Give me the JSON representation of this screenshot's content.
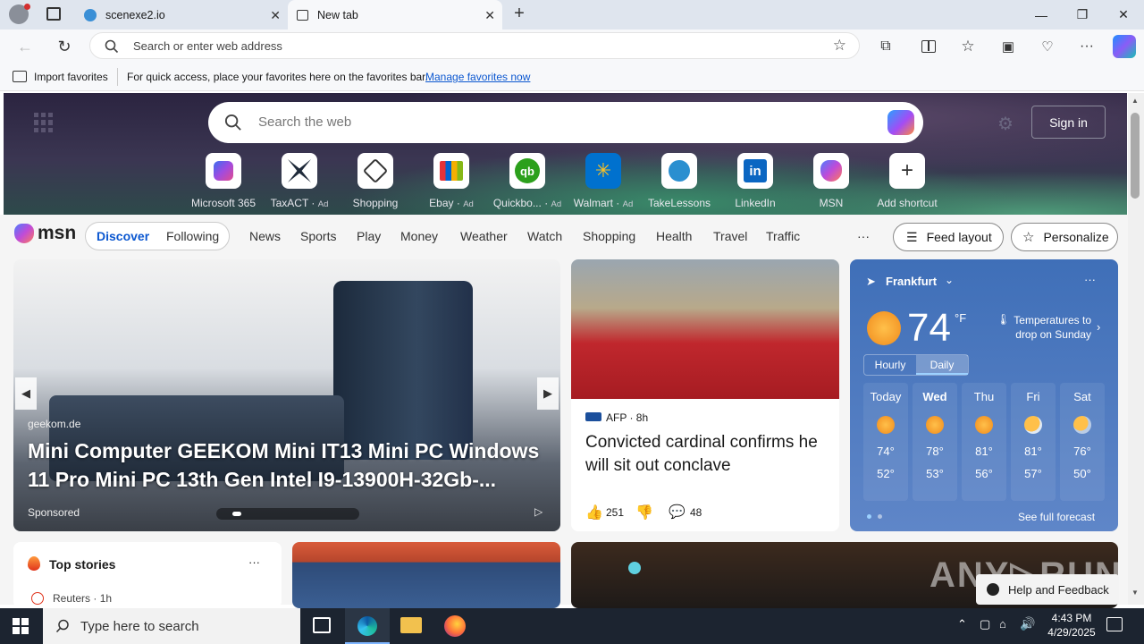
{
  "tabs": [
    {
      "title": "scenexe2.io"
    },
    {
      "title": "New tab"
    }
  ],
  "address": {
    "placeholder": "Search or enter web address"
  },
  "favorites_bar": {
    "import_label": "Import favorites",
    "message": "For quick access, place your favorites here on the favorites bar.",
    "manage_link": "Manage favorites now"
  },
  "hero": {
    "search_placeholder": "Search the web",
    "signin_label": "Sign in",
    "shortcuts": [
      {
        "label": "Microsoft 365",
        "ad": ""
      },
      {
        "label": "TaxACT",
        "ad": "Ad"
      },
      {
        "label": "Shopping",
        "ad": ""
      },
      {
        "label": "Ebay",
        "ad": "Ad"
      },
      {
        "label": "Quickbo...",
        "ad": "Ad"
      },
      {
        "label": "Walmart",
        "ad": "Ad"
      },
      {
        "label": "TakeLessons",
        "ad": ""
      },
      {
        "label": "LinkedIn",
        "ad": ""
      },
      {
        "label": "MSN",
        "ad": ""
      },
      {
        "label": "Add shortcut",
        "ad": ""
      }
    ]
  },
  "msn": {
    "logo": "msn",
    "discover": "Discover",
    "following": "Following",
    "nav": [
      "News",
      "Sports",
      "Play",
      "Money",
      "Weather",
      "Watch",
      "Shopping",
      "Health",
      "Travel",
      "Traffic"
    ],
    "more": "···",
    "feed_layout": "Feed layout",
    "personalize": "Personalize"
  },
  "promo": {
    "source": "geekom.de",
    "headline": "Mini Computer GEEKOM Mini IT13 Mini PC Windows 11 Pro Mini PC 13th Gen Intel I9-13900H-32Gb-...",
    "sponsored": "Sponsored"
  },
  "story": {
    "source": "AFP",
    "age": "8h",
    "headline": "Convicted cardinal confirms he will sit out conclave",
    "likes": "251",
    "comments": "48"
  },
  "weather": {
    "city": "Frankfurt",
    "temp": "74",
    "unit": "°F",
    "note": "Temperatures to drop on Sunday",
    "tab_hourly": "Hourly",
    "tab_daily": "Daily",
    "days": [
      {
        "day": "Today",
        "high": "74°",
        "low": "52°"
      },
      {
        "day": "Wed",
        "high": "78°",
        "low": "53°"
      },
      {
        "day": "Thu",
        "high": "81°",
        "low": "56°"
      },
      {
        "day": "Fri",
        "high": "81°",
        "low": "57°"
      },
      {
        "day": "Sat",
        "high": "76°",
        "low": "50°"
      }
    ],
    "forecast_link": "See full forecast"
  },
  "top_stories": {
    "title": "Top stories",
    "source": "Reuters",
    "age": "1h"
  },
  "help": {
    "label": "Help and Feedback"
  },
  "taskbar": {
    "search_placeholder": "Type here to search",
    "time": "4:43 PM",
    "date": "4/29/2025"
  }
}
